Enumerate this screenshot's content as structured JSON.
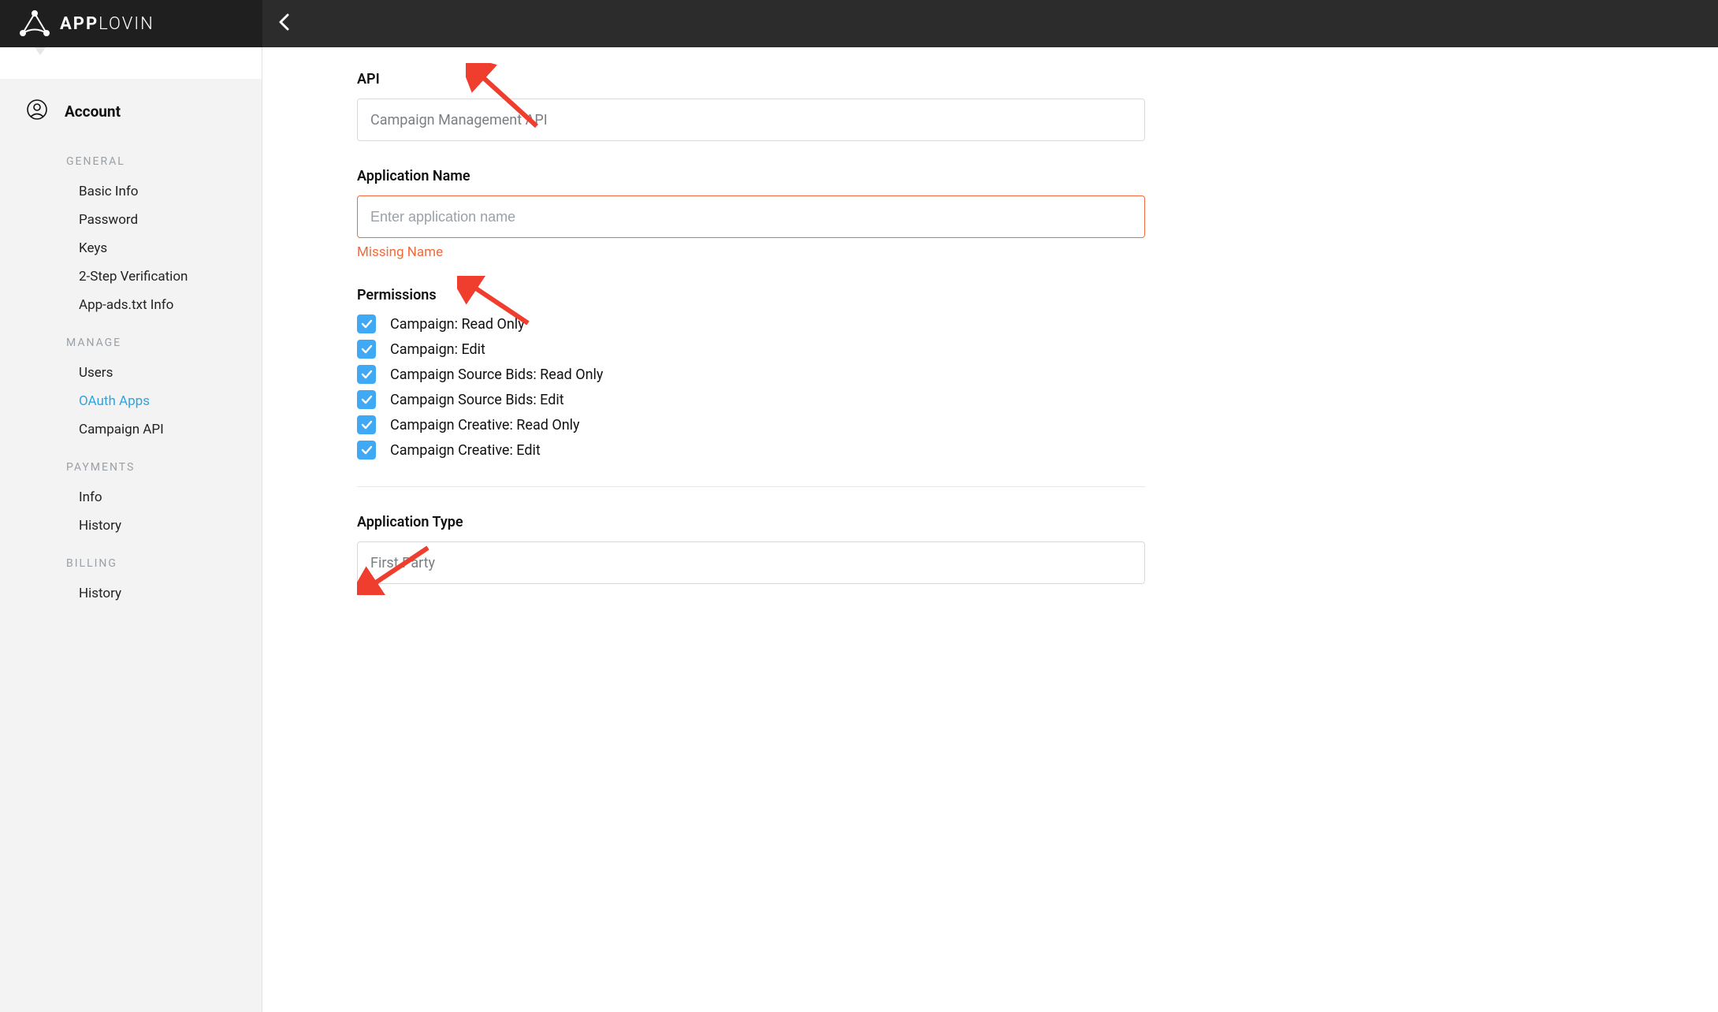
{
  "brand": {
    "bold": "APP",
    "light": "LOVIN"
  },
  "sidebar": {
    "account_label": "Account",
    "groups": [
      {
        "label": "GENERAL",
        "items": [
          {
            "label": "Basic Info",
            "key": "basic-info"
          },
          {
            "label": "Password",
            "key": "password"
          },
          {
            "label": "Keys",
            "key": "keys"
          },
          {
            "label": "2-Step Verification",
            "key": "2step"
          },
          {
            "label": "App-ads.txt Info",
            "key": "appads"
          }
        ]
      },
      {
        "label": "MANAGE",
        "items": [
          {
            "label": "Users",
            "key": "users"
          },
          {
            "label": "OAuth Apps",
            "key": "oauth",
            "active": true
          },
          {
            "label": "Campaign API",
            "key": "campaign-api"
          }
        ]
      },
      {
        "label": "PAYMENTS",
        "items": [
          {
            "label": "Info",
            "key": "pay-info"
          },
          {
            "label": "History",
            "key": "pay-history"
          }
        ]
      },
      {
        "label": "BILLING",
        "items": [
          {
            "label": "History",
            "key": "bill-history"
          }
        ]
      }
    ]
  },
  "main": {
    "api": {
      "label": "API",
      "value": "Campaign Management API"
    },
    "app_name": {
      "label": "Application Name",
      "placeholder": "Enter application name",
      "value": "",
      "error": "Missing Name"
    },
    "permissions": {
      "label": "Permissions",
      "items": [
        {
          "label": "Campaign: Read Only",
          "checked": true
        },
        {
          "label": "Campaign: Edit",
          "checked": true
        },
        {
          "label": "Campaign Source Bids: Read Only",
          "checked": true
        },
        {
          "label": "Campaign Source Bids: Edit",
          "checked": true
        },
        {
          "label": "Campaign Creative: Read Only",
          "checked": true
        },
        {
          "label": "Campaign Creative: Edit",
          "checked": true
        }
      ]
    },
    "app_type": {
      "label": "Application Type",
      "value": "First Party"
    }
  },
  "colors": {
    "accent": "#3fa9f5",
    "error": "#f26a3b",
    "arrow": "#ef3d2e"
  }
}
